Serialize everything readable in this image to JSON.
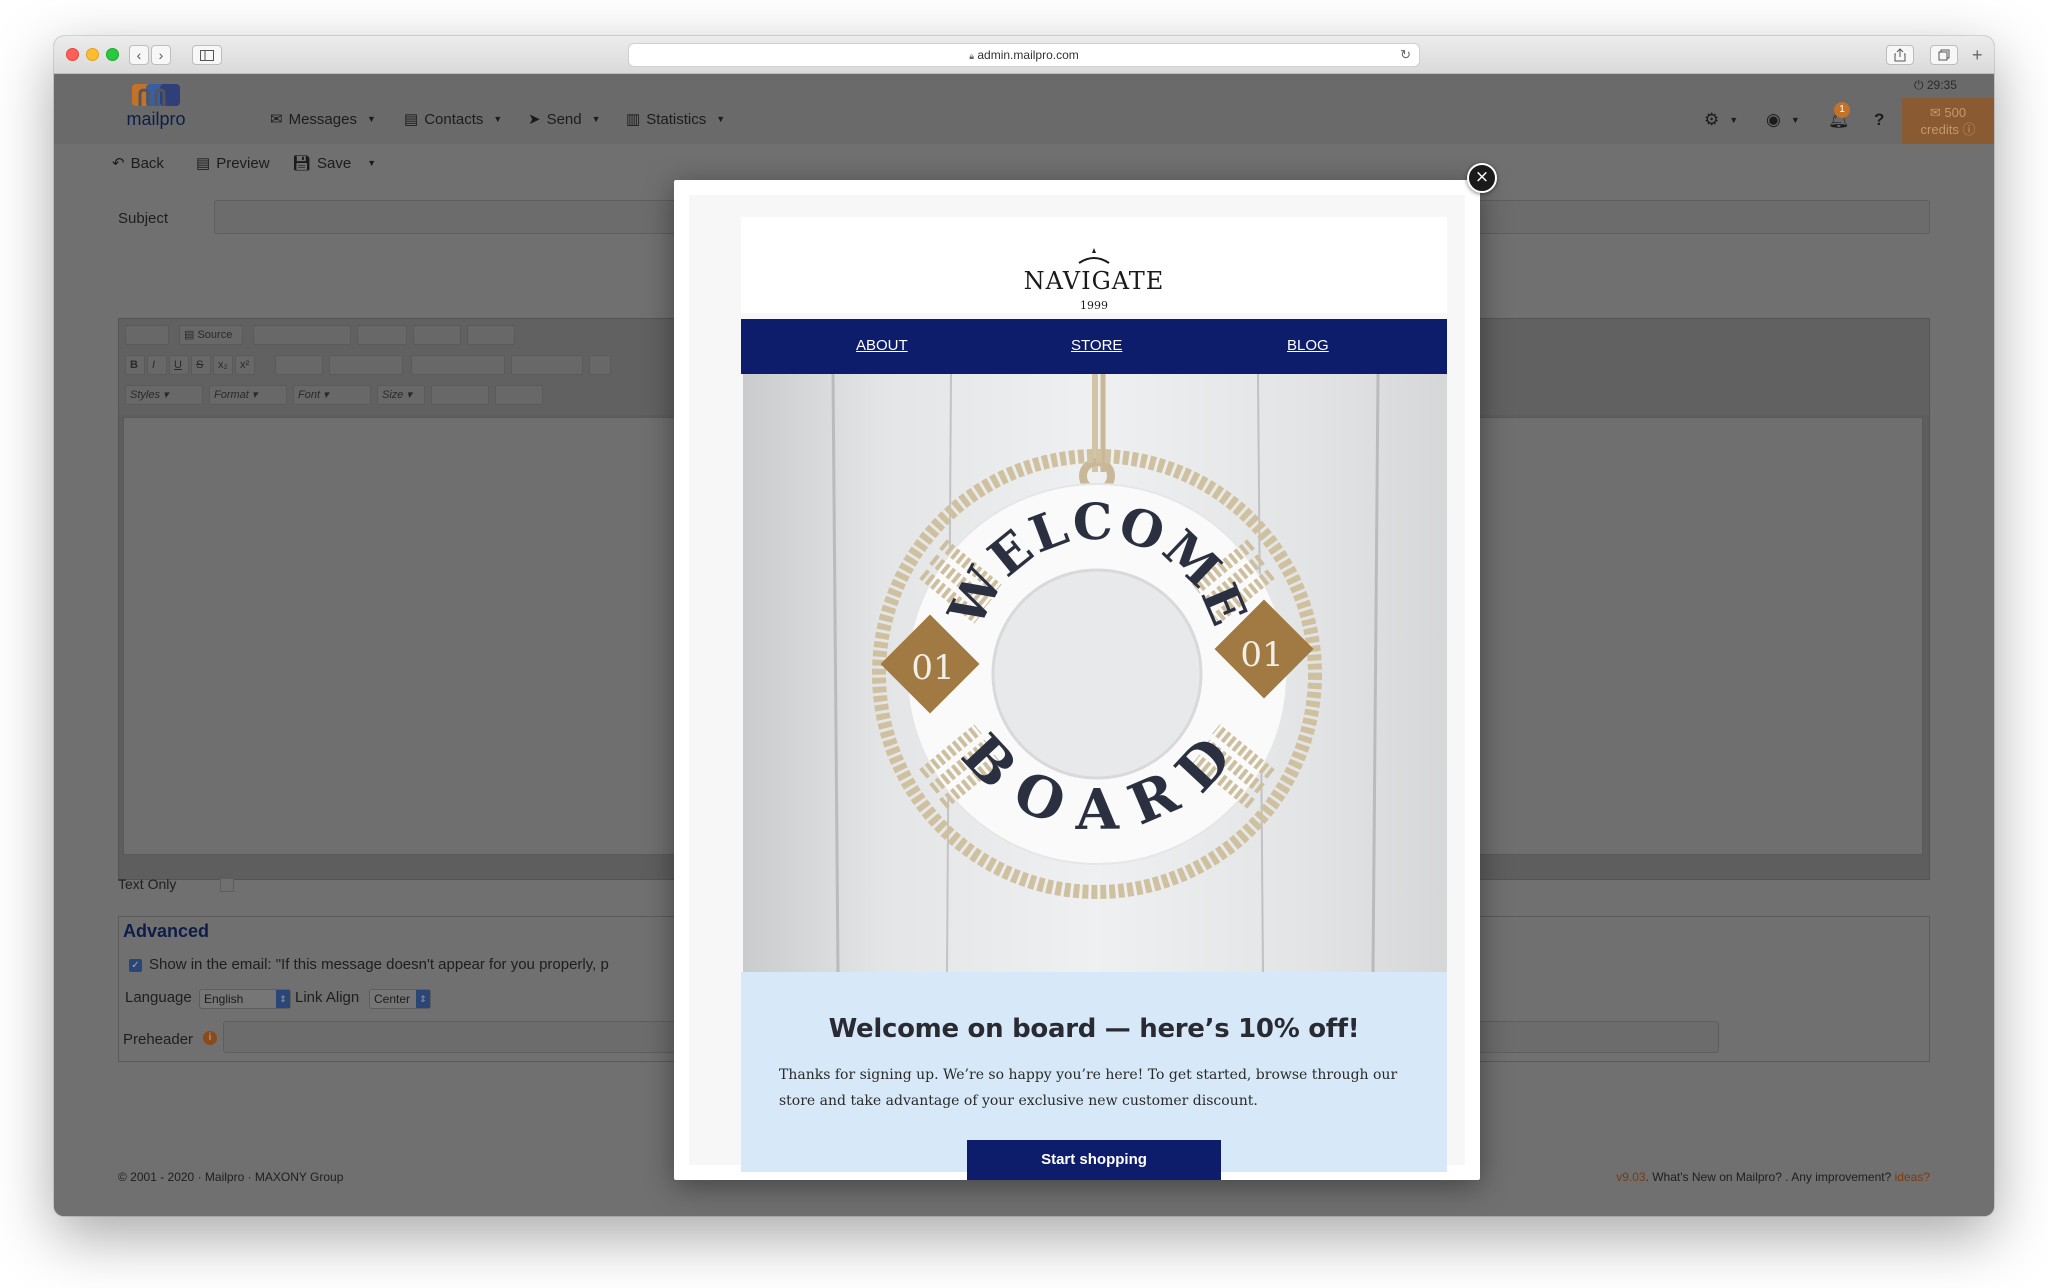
{
  "browser": {
    "url": "admin.mailpro.com"
  },
  "app": {
    "logo_text": "mailpro",
    "nav": {
      "messages": "Messages",
      "contacts": "Contacts",
      "send": "Send",
      "statistics": "Statistics"
    },
    "timer": "29:35",
    "notification_count": "1",
    "credits_amount": "500",
    "credits_label": "credits",
    "help": "?",
    "toolbar": {
      "back": "Back",
      "preview": "Preview",
      "save": "Save"
    },
    "subject_label": "Subject",
    "editor": {
      "source_label": "Source",
      "styles": "Styles",
      "format": "Format",
      "font": "Font",
      "size": "Size"
    },
    "text_only_label": "Text Only",
    "advanced": {
      "title": "Advanced",
      "show_in_email": "Show in the email: \"If this message doesn't appear for you properly, p",
      "language_label": "Language",
      "language_value": "English",
      "link_align_label": "Link Align",
      "link_align_value": "Center",
      "preheader_label": "Preheader"
    },
    "footer": {
      "copyright": "© 2001 - 2020 · Mailpro · MAXONY Group",
      "version": "v9.03",
      "whats_new": ". What's New on Mailpro? . Any improvement?",
      "ideas": "ideas?"
    }
  },
  "email_preview": {
    "brand_name": "NAVIGATE",
    "brand_year": "1999",
    "nav": [
      "ABOUT",
      "STORE",
      "BLOG"
    ],
    "hero_text_top": "WELCOME",
    "hero_text_bottom": "BOARD",
    "hero_badge": "01",
    "headline": "Welcome on board — here’s 10% off!",
    "body": "Thanks for signing up. We’re so happy you’re here! To get started, browse through our store and take advantage of your exclusive new customer discount.",
    "cta": "Start shopping"
  },
  "colors": {
    "email_nav_bg": "#0e1d6b",
    "promo_bg": "#d7e9f8",
    "credits_orange": "#c4722a",
    "overlay_gray": "#707070"
  },
  "icons": [
    "close-icon",
    "back-icon",
    "preview-icon",
    "save-icon",
    "gear-icon",
    "user-icon",
    "bell-icon",
    "help-icon",
    "envelope-icon",
    "contacts-icon",
    "send-icon",
    "chart-icon",
    "lock-icon",
    "reload-icon",
    "share-icon",
    "tabs-icon",
    "sidebar-icon",
    "info-icon"
  ]
}
